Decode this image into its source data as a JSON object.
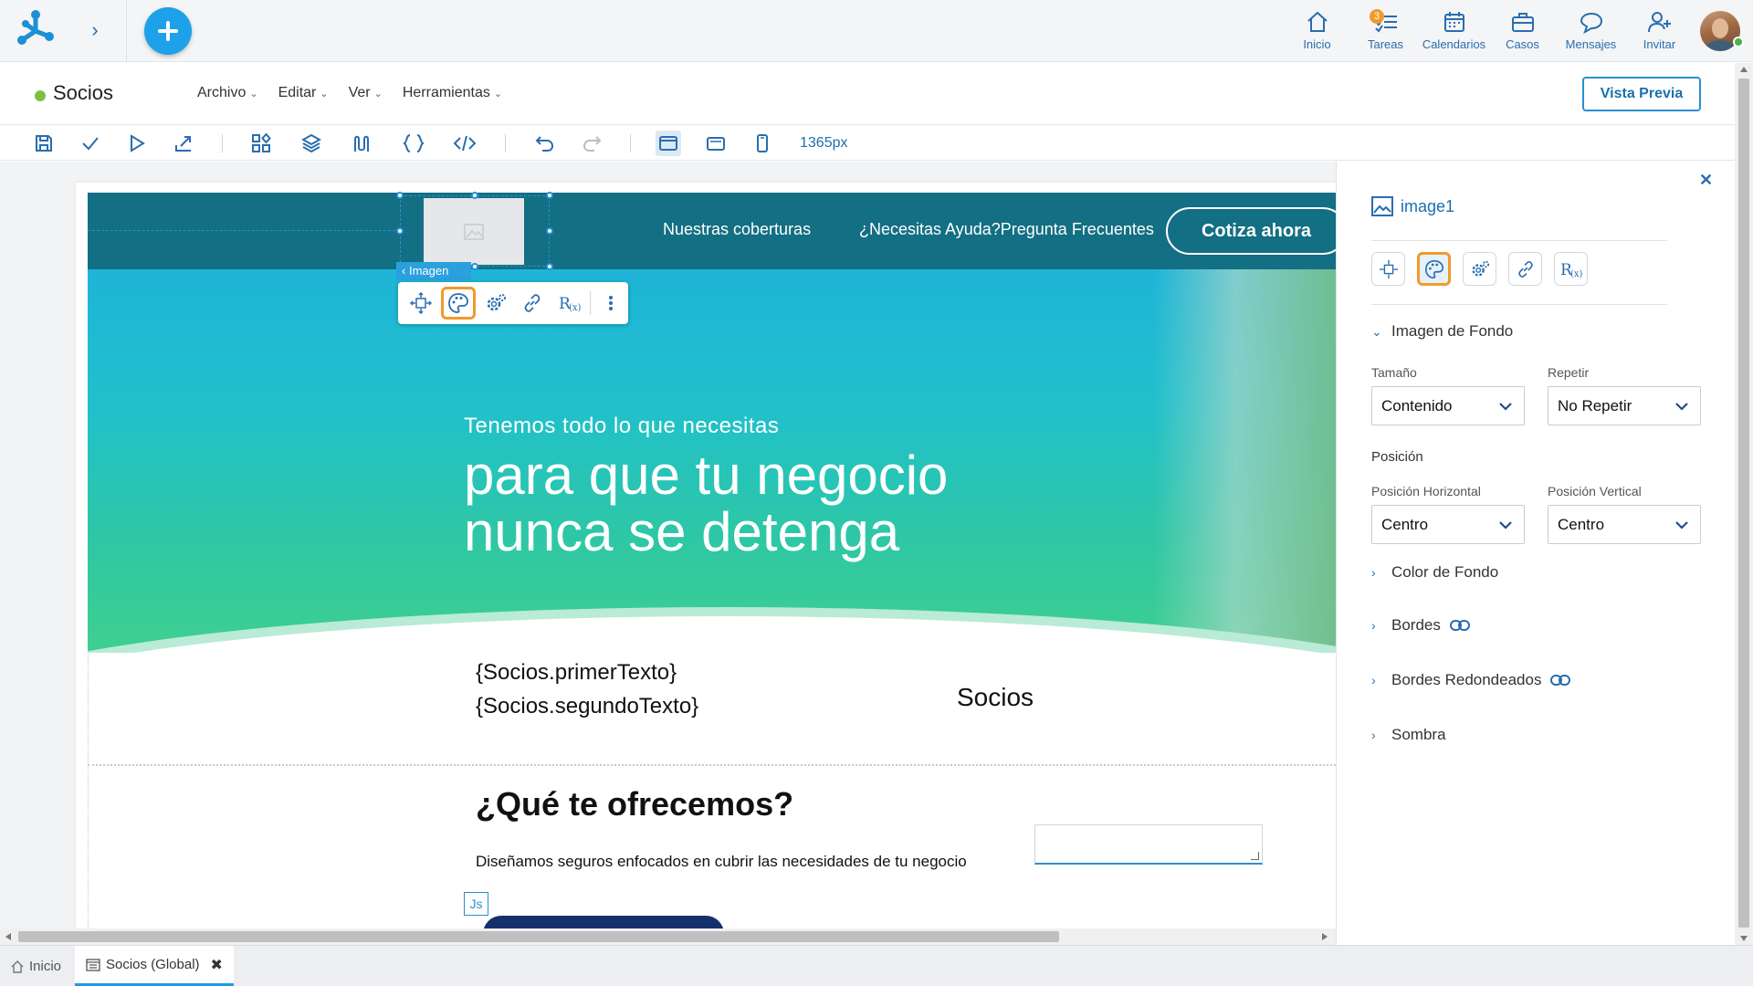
{
  "topbar": {
    "nav": [
      {
        "label": "Inicio",
        "icon": "home-icon"
      },
      {
        "label": "Tareas",
        "icon": "tasks-icon",
        "badge": "3"
      },
      {
        "label": "Calendarios",
        "icon": "calendar-icon"
      },
      {
        "label": "Casos",
        "icon": "briefcase-icon"
      },
      {
        "label": "Mensajes",
        "icon": "chat-icon"
      },
      {
        "label": "Invitar",
        "icon": "add-user-icon"
      }
    ]
  },
  "doc": {
    "title": "Socios",
    "menus": [
      "Archivo",
      "Editar",
      "Ver",
      "Herramientas"
    ],
    "preview_label": "Vista Previa"
  },
  "toolbar": {
    "width_label": "1365px"
  },
  "canvas": {
    "nav_links": [
      "Nuestras coberturas",
      "¿Necesitas Ayuda?Pregunta Frecuentes"
    ],
    "cta_label": "Cotiza ahora",
    "image_tag": "Imagen",
    "hero_subtitle": "Tenemos todo lo que necesitas",
    "hero_title": "para que tu negocio nunca se detenga",
    "template_line1": "{Socios.primerTexto}",
    "template_line2": "{Socios.segundoTexto}",
    "page_label": "Socios",
    "offer_title": "¿Qué te ofrecemos?",
    "offer_text": "Diseñamos seguros enfocados en cubrir las necesidades de tu negocio",
    "js_tag": "Js"
  },
  "panel": {
    "element_name": "image1",
    "section_background_image": "Imagen de Fondo",
    "size_label": "Tamaño",
    "size_value": "Contenido",
    "repeat_label": "Repetir",
    "repeat_value": "No Repetir",
    "position_label": "Posición",
    "pos_h_label": "Posición Horizontal",
    "pos_h_value": "Centro",
    "pos_v_label": "Posición Vertical",
    "pos_v_value": "Centro",
    "section_bg_color": "Color de Fondo",
    "section_borders": "Bordes",
    "section_rounded": "Bordes Redondeados",
    "section_shadow": "Sombra"
  },
  "bottom_tabs": [
    {
      "label": "Inicio"
    },
    {
      "label": "Socios (Global)"
    }
  ],
  "colors": {
    "accent": "#1da1e8",
    "brand_blue": "#2a6db0",
    "active_outline": "#f09a2a",
    "site_nav": "#136f83",
    "status_online": "#7cc142"
  }
}
